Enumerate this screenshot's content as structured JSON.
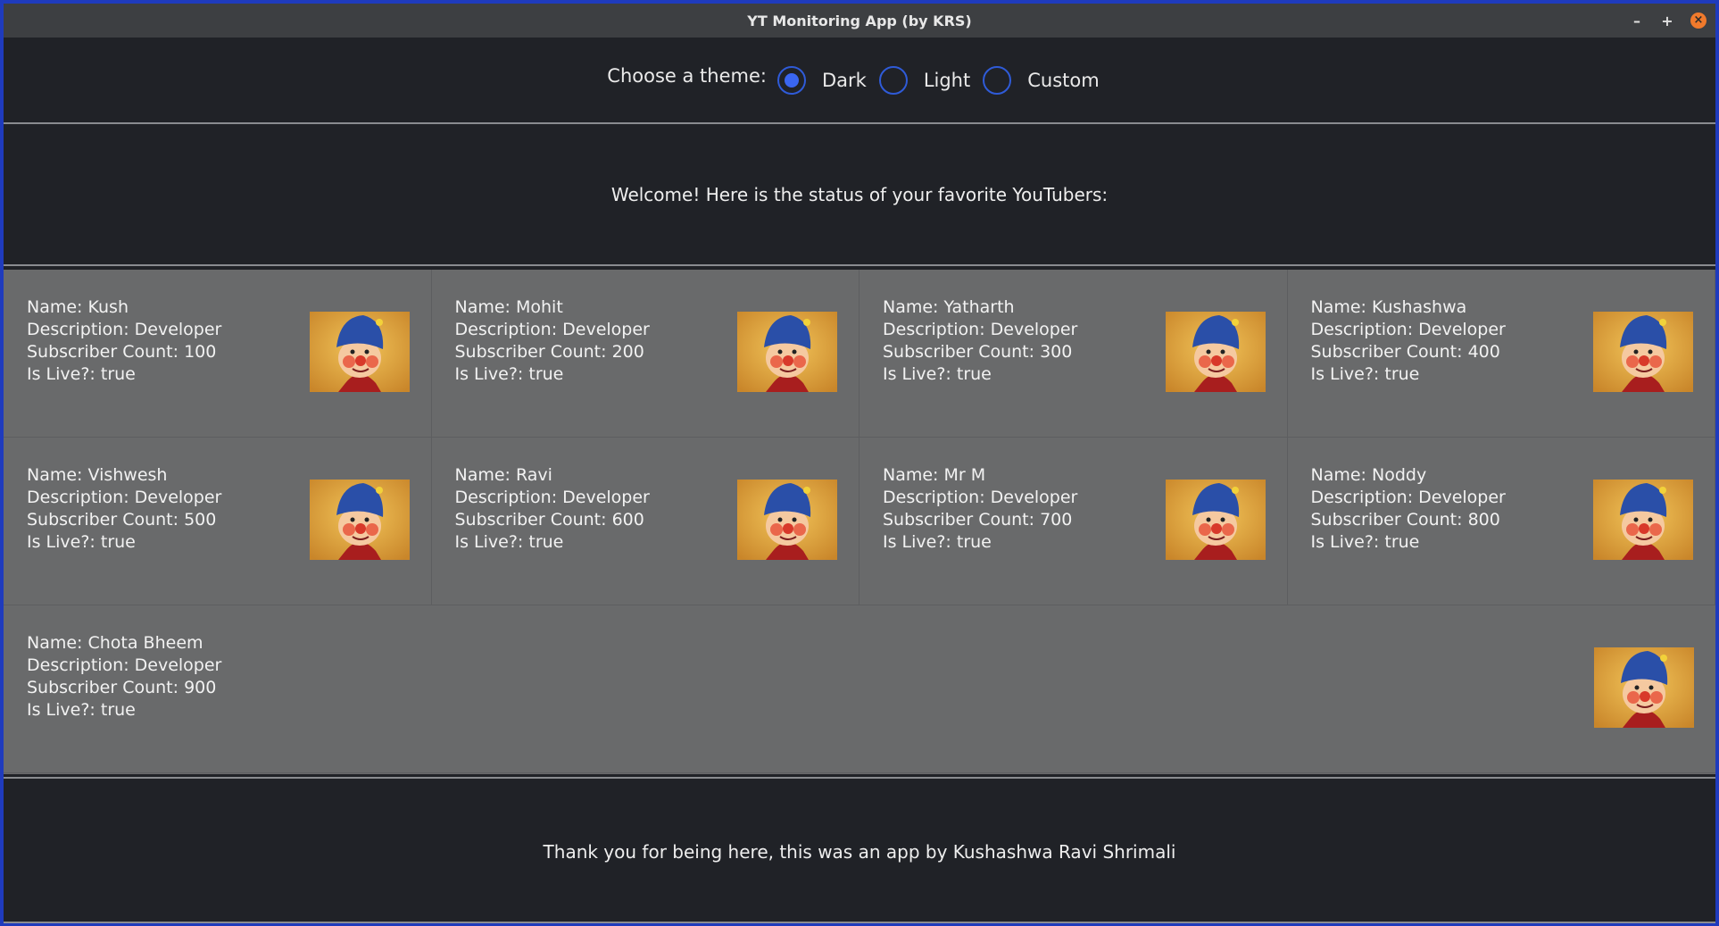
{
  "window": {
    "title": "YT Monitoring App (by KRS)",
    "controls": {
      "minimize": "–",
      "maximize": "+",
      "close": "×"
    }
  },
  "theme": {
    "label": "Choose a theme:",
    "options": [
      {
        "label": "Dark",
        "selected": true
      },
      {
        "label": "Light",
        "selected": false
      },
      {
        "label": "Custom",
        "selected": false
      }
    ]
  },
  "welcome": "Welcome! Here is the status of your favorite YouTubers:",
  "youtubers": [
    {
      "name": "Name: Kush",
      "description": "Description: Developer",
      "subs": "Subscriber Count: 100",
      "live": "Is Live?: true"
    },
    {
      "name": "Name: Mohit",
      "description": "Description: Developer",
      "subs": "Subscriber Count: 200",
      "live": "Is Live?: true"
    },
    {
      "name": "Name: Yatharth",
      "description": "Description: Developer",
      "subs": "Subscriber Count: 300",
      "live": "Is Live?: true"
    },
    {
      "name": "Name: Kushashwa",
      "description": "Description: Developer",
      "subs": "Subscriber Count: 400",
      "live": "Is Live?: true"
    },
    {
      "name": "Name: Vishwesh",
      "description": "Description: Developer",
      "subs": "Subscriber Count: 500",
      "live": "Is Live?: true"
    },
    {
      "name": "Name: Ravi",
      "description": "Description: Developer",
      "subs": "Subscriber Count: 600",
      "live": "Is Live?: true"
    },
    {
      "name": "Name: Mr M",
      "description": "Description: Developer",
      "subs": "Subscriber Count: 700",
      "live": "Is Live?: true"
    },
    {
      "name": "Name: Noddy",
      "description": "Description: Developer",
      "subs": "Subscriber Count: 800",
      "live": "Is Live?: true"
    },
    {
      "name": "Name: Chota Bheem",
      "description": "Description: Developer",
      "subs": "Subscriber Count: 900",
      "live": "Is Live?: true"
    }
  ],
  "avatar_icon": "cartoon-character-avatar-icon",
  "footer": "Thank you for being here, this was an app by Kushashwa Ravi Shrimali",
  "colors": {
    "accent": "#3a66f0",
    "border": "#1f3bbd",
    "card_bg": "#696a6b",
    "app_bg": "#202227"
  }
}
